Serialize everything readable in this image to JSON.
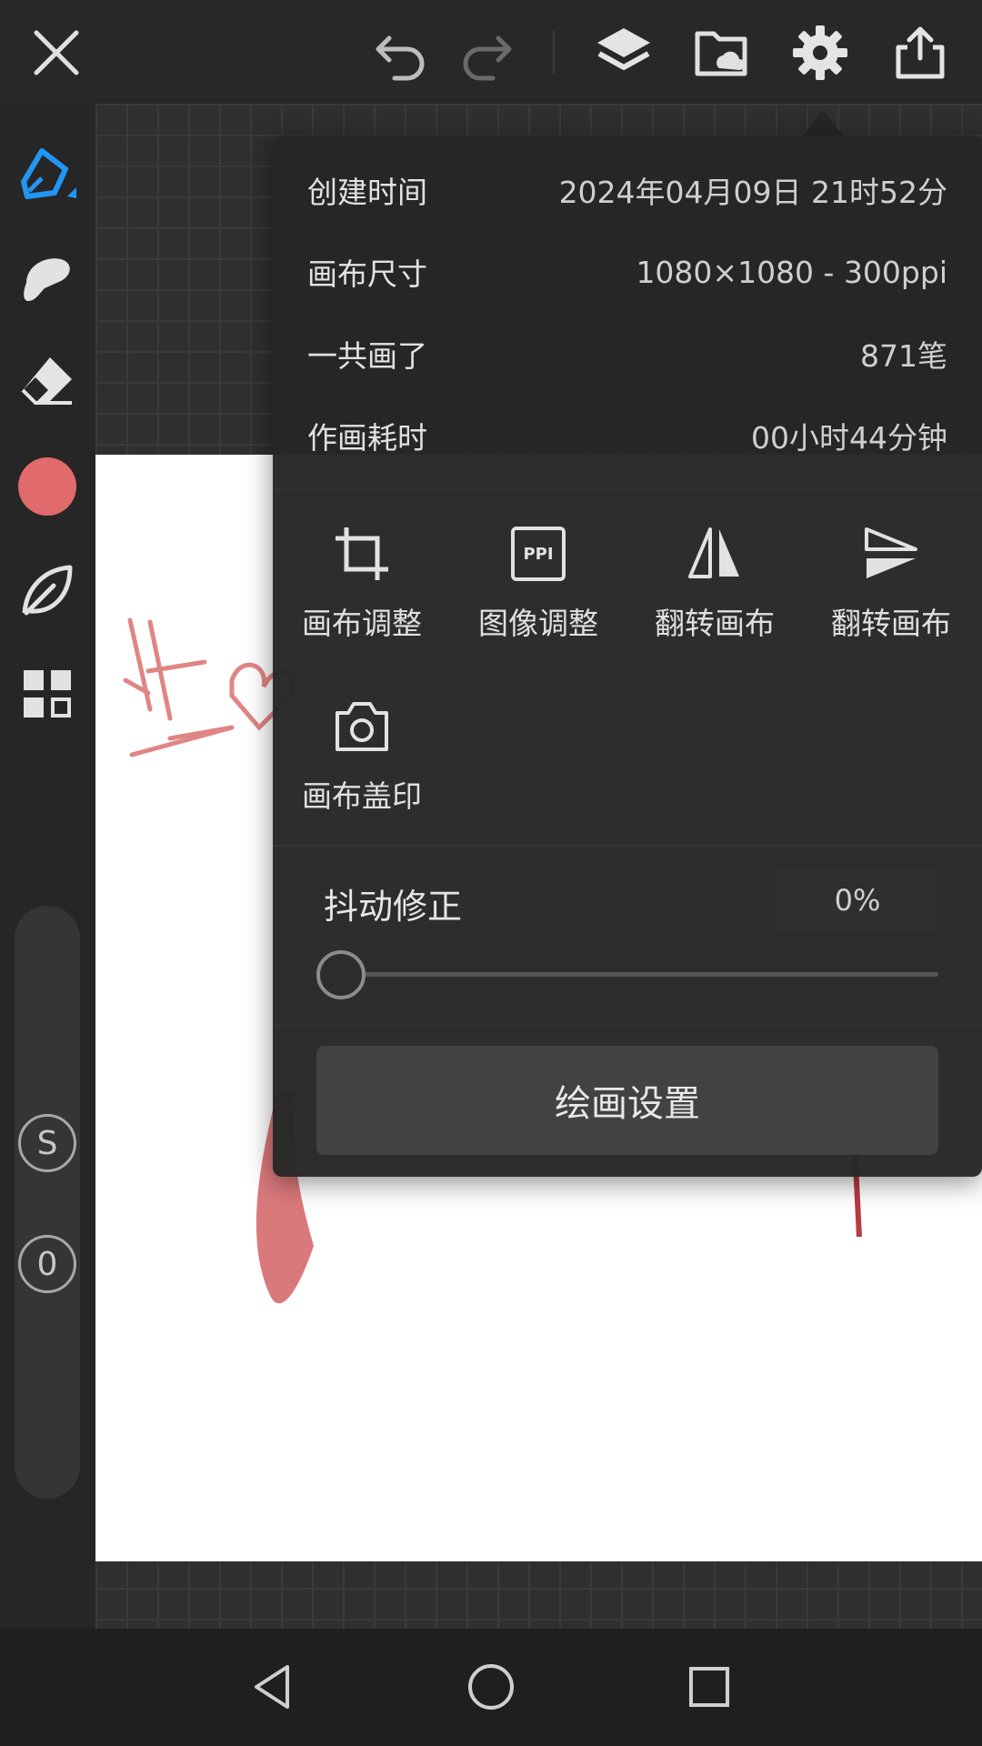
{
  "colors": {
    "accent": "#2196f3",
    "brush_color": "#e06a6c",
    "panel_bg": "#262626"
  },
  "topbar": {
    "icons": [
      "close-icon",
      "undo-icon",
      "redo-icon",
      "layers-icon",
      "cloud-folder-icon",
      "gear-icon",
      "share-icon"
    ]
  },
  "lefttools": {
    "icons": [
      "pen-icon",
      "smudge-icon",
      "eraser-icon",
      "color-swatch",
      "leaf-icon",
      "grid-icon"
    ],
    "s_button": "S",
    "o_button": "0"
  },
  "info": {
    "rows": [
      {
        "key": "创建时间",
        "value": "2024年04月09日 21时52分"
      },
      {
        "key": "画布尺寸",
        "value": "1080×1080 - 300ppi"
      },
      {
        "key": "一共画了",
        "value": "871笔"
      },
      {
        "key": "作画耗时",
        "value": "00小时44分钟"
      }
    ]
  },
  "tools": [
    {
      "label": "画布调整",
      "icon": "crop-icon"
    },
    {
      "label": "图像调整",
      "icon": "ppi-icon",
      "icon_text": "PPI"
    },
    {
      "label": "翻转画布",
      "icon": "flip-horizontal-icon"
    },
    {
      "label": "翻转画布",
      "icon": "flip-vertical-icon"
    },
    {
      "label": "画布盖印",
      "icon": "camera-icon"
    }
  ],
  "jitter": {
    "label": "抖动修正",
    "value_text": "0%",
    "value": 0
  },
  "settings_button": "绘画设置",
  "navbar": {
    "icons": [
      "back-icon",
      "home-icon",
      "recents-icon"
    ]
  }
}
